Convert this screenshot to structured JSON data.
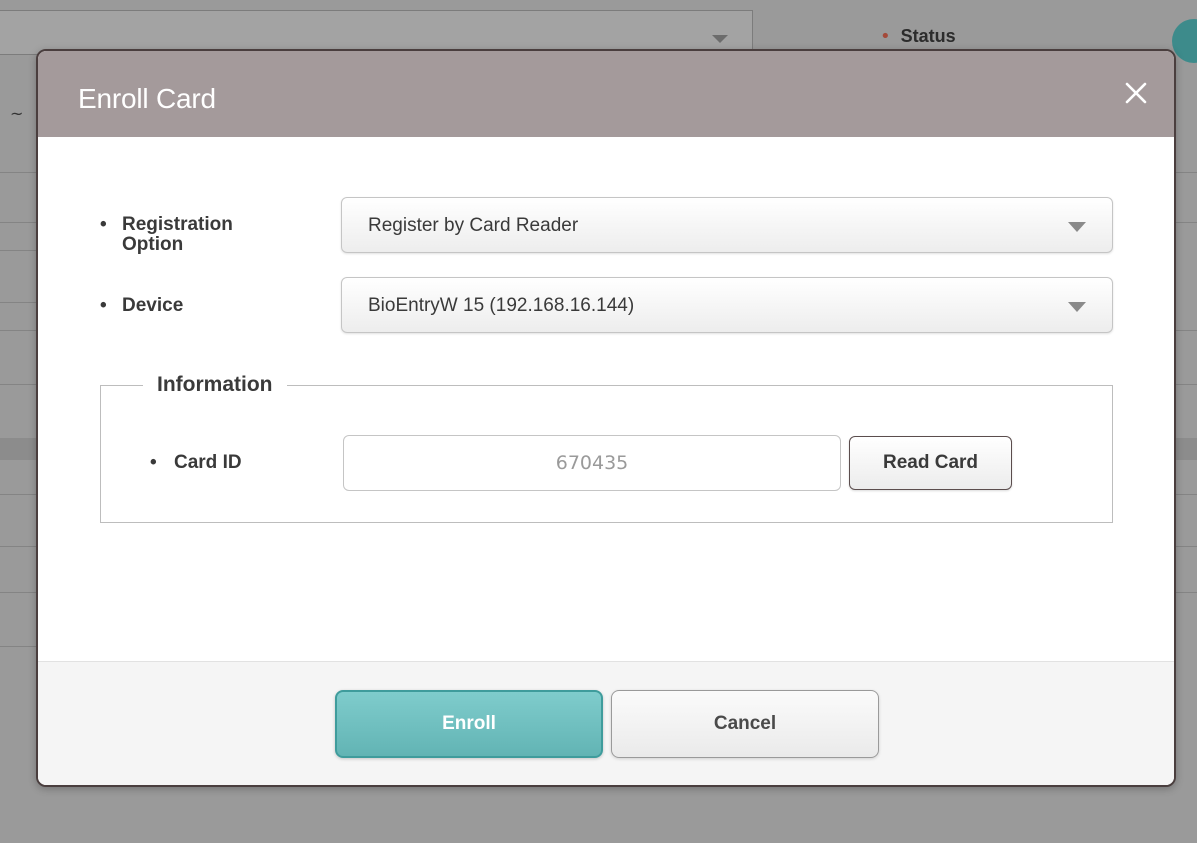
{
  "background": {
    "status_label": "Status",
    "status_bullet": "•",
    "range_separator": "~",
    "status_bullet_color": "#a44a3a",
    "accent_circle_color": "#3d8b8b"
  },
  "modal": {
    "title": "Enroll Card",
    "close_icon": "close-icon",
    "header_color": "#a49a9b",
    "fields": {
      "bullet": "•",
      "registration_option": {
        "label": "Registration Option",
        "value": "Register by Card Reader"
      },
      "device": {
        "label": "Device",
        "value": "BioEntryW 15 (192.168.16.144)"
      }
    },
    "information": {
      "legend": "Information",
      "card_id": {
        "label": "Card ID",
        "value": "670435"
      },
      "read_card_label": "Read Card"
    },
    "footer": {
      "enroll_label": "Enroll",
      "cancel_label": "Cancel",
      "enroll_color": "#6fc0c0"
    }
  }
}
